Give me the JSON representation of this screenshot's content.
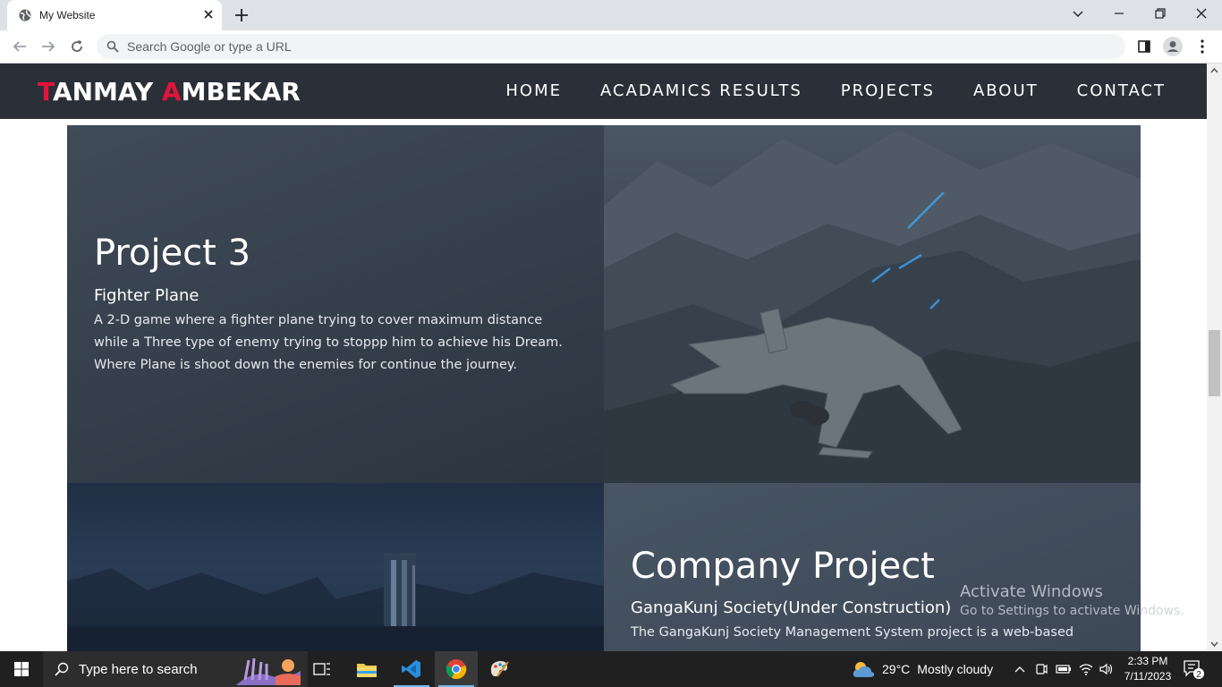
{
  "browser": {
    "tab_title": "My Website",
    "omnibox_placeholder": "Search Google or type a URL"
  },
  "site": {
    "logo": {
      "first_initial": "T",
      "first_rest": "ANMAY ",
      "last_initial": "A",
      "last_rest": "MBEKAR"
    },
    "nav": [
      "HOME",
      "ACADAMICS RESULTS",
      "PROJECTS",
      "ABOUT",
      "CONTACT"
    ],
    "projects": [
      {
        "title": "Project 3",
        "subtitle": "Fighter Plane",
        "description": "A 2-D game where a fighter plane trying to cover maximum distance while a Three type of enemy trying to stoppp him to achieve his Dream. Where Plane is shoot down the enemies for continue the journey."
      },
      {
        "title": "Company Project",
        "subtitle": "GangaKunj Society(Under Construction)",
        "description": "The GangaKunj Society Management System project is a web-based"
      }
    ]
  },
  "watermark": {
    "line1": "Activate Windows",
    "line2": "Go to Settings to activate Windows."
  },
  "taskbar": {
    "search_placeholder": "Type here to search",
    "weather_temp": "29°C",
    "weather_desc": "Mostly cloudy",
    "time": "2:33 PM",
    "date": "7/11/2023",
    "notification_count": "2"
  },
  "colors": {
    "accent": "#e0143c",
    "nav_bg": "#2b2f37",
    "taskbar_bg": "#202020"
  }
}
